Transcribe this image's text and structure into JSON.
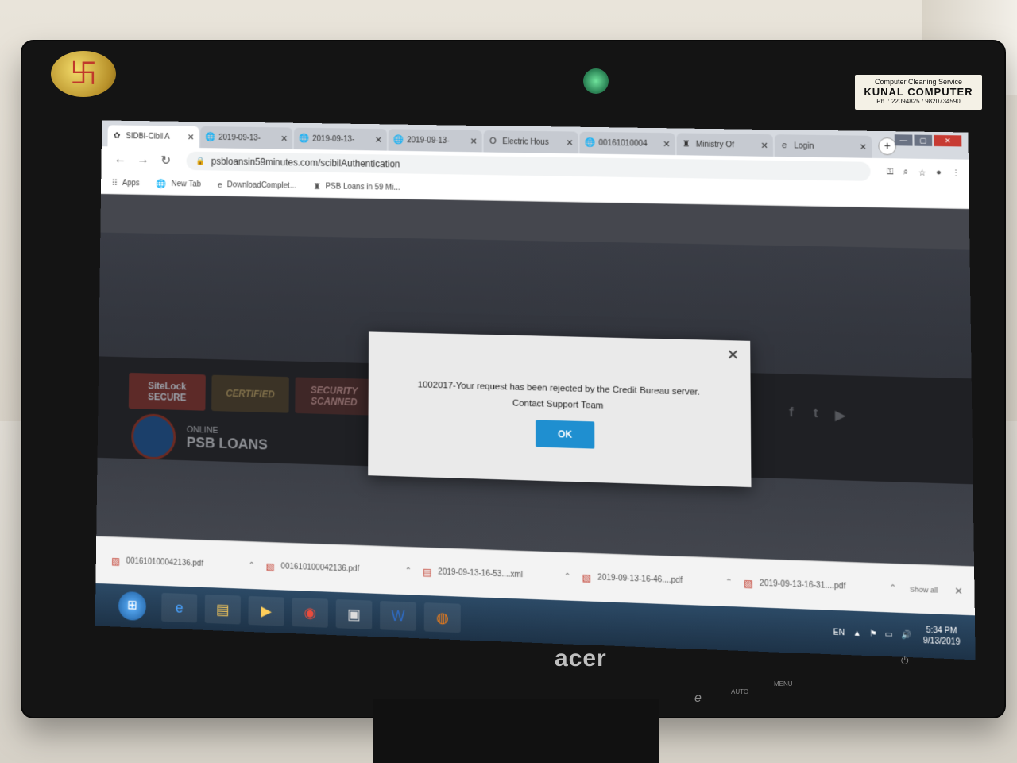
{
  "sticker": {
    "line1": "Computer Cleaning Service",
    "line2": "KUNAL COMPUTER",
    "line3": "Ph. : 22094825 / 9820734590"
  },
  "browser": {
    "tabs": [
      {
        "label": "SIDBI-Cibil A",
        "icon": "sidbi-icon",
        "glyph": "✿",
        "active": true
      },
      {
        "label": "2019-09-13-",
        "icon": "globe-icon",
        "glyph": "🌐"
      },
      {
        "label": "2019-09-13-",
        "icon": "globe-icon",
        "glyph": "🌐"
      },
      {
        "label": "2019-09-13-",
        "icon": "globe-icon",
        "glyph": "🌐"
      },
      {
        "label": "Electric Hous",
        "icon": "outlook-icon",
        "glyph": "O"
      },
      {
        "label": "00161010004",
        "icon": "globe-icon",
        "glyph": "🌐"
      },
      {
        "label": "Ministry Of",
        "icon": "emblem-icon",
        "glyph": "♜"
      },
      {
        "label": "Login",
        "icon": "ie-icon",
        "glyph": "e"
      }
    ],
    "url": "psbloansin59minutes.com/scibilAuthentication",
    "bookmarks": [
      {
        "label": "Apps",
        "icon": "apps-grid-icon",
        "glyph": "⠿"
      },
      {
        "label": "New Tab",
        "icon": "globe-icon",
        "glyph": "🌐"
      },
      {
        "label": "DownloadComplet...",
        "icon": "ie-icon",
        "glyph": "e"
      },
      {
        "label": "PSB Loans in 59 Mi...",
        "icon": "psb-icon",
        "glyph": "♜"
      }
    ]
  },
  "page": {
    "badges": {
      "sitelock_1": "SiteLock",
      "sitelock_2": "SECURE",
      "certified": "CERTIFIED",
      "security_1": "SECURITY",
      "security_2": "SCANNED"
    },
    "brand": {
      "line1": "ONLINE",
      "line2": "PSB LOANS"
    }
  },
  "modal": {
    "line1": "1002017-Your request has been rejected by the Credit Bureau server.",
    "line2": "Contact Support Team",
    "ok_label": "OK"
  },
  "downloads": {
    "items": [
      {
        "label": "001610100042136.pdf",
        "type": "pdf"
      },
      {
        "label": "001610100042136.pdf",
        "type": "pdf"
      },
      {
        "label": "2019-09-13-16-53....xml",
        "type": "xml"
      },
      {
        "label": "2019-09-13-16-46....pdf",
        "type": "pdf"
      },
      {
        "label": "2019-09-13-16-31....pdf",
        "type": "pdf"
      }
    ],
    "show_all": "Show all"
  },
  "taskbar": {
    "lang": "EN",
    "time": "5:34 PM",
    "date": "9/13/2019"
  },
  "monitor": {
    "brand": "acer",
    "auto_label": "AUTO",
    "menu_label": "MENU"
  }
}
